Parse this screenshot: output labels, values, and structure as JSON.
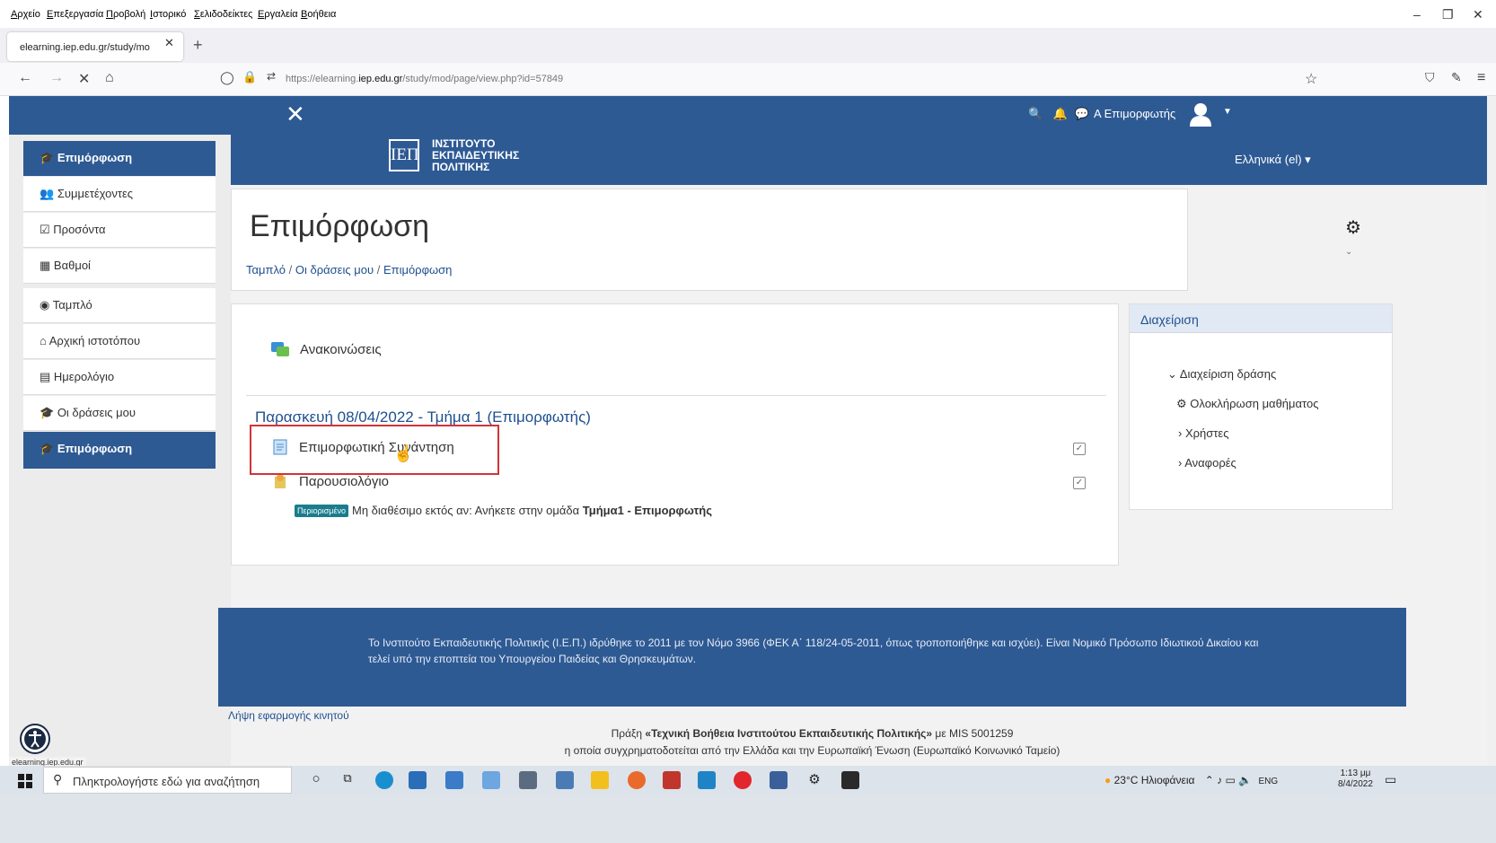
{
  "browser": {
    "menu": [
      "Αρχείο",
      "Επεξεργασία",
      "Προβολή",
      "Ιστορικό",
      "Σελιδοδείκτες",
      "Εργαλεία",
      "Βοήθεια"
    ],
    "tab_title": "elearning.iep.edu.gr/study/mo",
    "url_prefix": "https://elearning.",
    "url_domain": "iep.edu.gr",
    "url_path": "/study/mod/page/view.php?id=57849",
    "status_url": "elearning.iep.edu.gr"
  },
  "topnav": {
    "user": "Α Επιμορφωτής"
  },
  "sidebar": {
    "items": [
      {
        "icon": "graduation-cap-icon",
        "glyph": "🎓",
        "label": "Επιμόρφωση",
        "active": true
      },
      {
        "icon": "users-icon",
        "glyph": "👥",
        "label": "Συμμετέχοντες"
      },
      {
        "icon": "checkbox-icon",
        "glyph": "☑",
        "label": "Προσόντα"
      },
      {
        "icon": "table-icon",
        "glyph": "▦",
        "label": "Βαθμοί"
      },
      {
        "icon": "dashboard-icon",
        "glyph": "◉",
        "label": "Ταμπλό"
      },
      {
        "icon": "home-icon",
        "glyph": "⌂",
        "label": "Αρχική ιστοτόπου"
      },
      {
        "icon": "calendar-icon",
        "glyph": "▤",
        "label": "Ημερολόγιο"
      },
      {
        "icon": "graduation-cap-icon",
        "glyph": "🎓",
        "label": "Οι δράσεις μου"
      },
      {
        "icon": "graduation-cap-icon",
        "glyph": "🎓",
        "label": "Επιμόρφωση",
        "active": true
      }
    ]
  },
  "brand": {
    "logo": "ΙΕΠ",
    "line1": "ΙΝΣΤΙΤΟΥΤΟ",
    "line2": "ΕΚΠΑΙΔΕΥΤΙΚΗΣ",
    "line3": "ΠΟΛΙΤΙΚΗΣ",
    "language": "Ελληνικά (el) ▾"
  },
  "page": {
    "title": "Επιμόρφωση",
    "breadcrumb": [
      "Ταμπλό",
      "Οι δράσεις μου",
      "Επιμόρφωση"
    ]
  },
  "course": {
    "announcements": "Ανακοινώσεις",
    "section_title": "Παρασκευή 08/04/2022 - Τμήμα 1 (Επιμορφωτής)",
    "activities": [
      {
        "label": "Επιμορφωτική Συνάντηση",
        "icon": "page-icon"
      },
      {
        "label": "Παρουσιολόγιο",
        "icon": "attendance-icon"
      }
    ],
    "restriction_badge": "Περιορισμένο",
    "restriction_text": "Μη διαθέσιμο εκτός αν: Ανήκετε στην ομάδα",
    "restriction_group": "Τμήμα1 - Επιμορφωτής"
  },
  "admin": {
    "title": "Διαχείριση",
    "items": [
      "Διαχείριση δράσης",
      "Ολοκλήρωση μαθήματος",
      "Χρήστες",
      "Αναφορές"
    ]
  },
  "footer": {
    "text": "Το Ινστιτούτο Εκπαιδευτικής Πολιτικής (Ι.Ε.Π.) ιδρύθηκε το 2011 με τον Νόμο 3966 (ΦΕΚ Α΄ 118/24-05-2011, όπως τροποποιήθηκε και ισχύει). Είναι Νομικό Πρόσωπο Ιδιωτικού Δικαίου και τελεί υπό την εποπτεία του Υπουργείου Παιδείας και Θρησκευμάτων.",
    "app_link": "Λήψη εφαρμογής κινητού",
    "line1_pre": "Πράξη ",
    "line1_bold": "«Τεχνική Βοήθεια Ινστιτούτου Εκπαιδευτικής Πολιτικής»",
    "line1_post": " με MIS 5001259",
    "line2": "η οποία συγχρηματοδοτείται από την Ελλάδα και την Ευρωπαϊκή Ένωση (Ευρωπαϊκό Κοινωνικό Ταμείο)"
  },
  "taskbar": {
    "search_placeholder": "Πληκτρολογήστε εδώ για αναζήτηση",
    "weather": "23°C Ηλιοφάνεια",
    "lang": "ENG",
    "time": "1:13 μμ",
    "date": "8/4/2022"
  },
  "colors": {
    "primary": "#2e5a94",
    "link": "#1f4f8f",
    "highlight": "#d0343a",
    "badge": "#1a7c8c"
  }
}
